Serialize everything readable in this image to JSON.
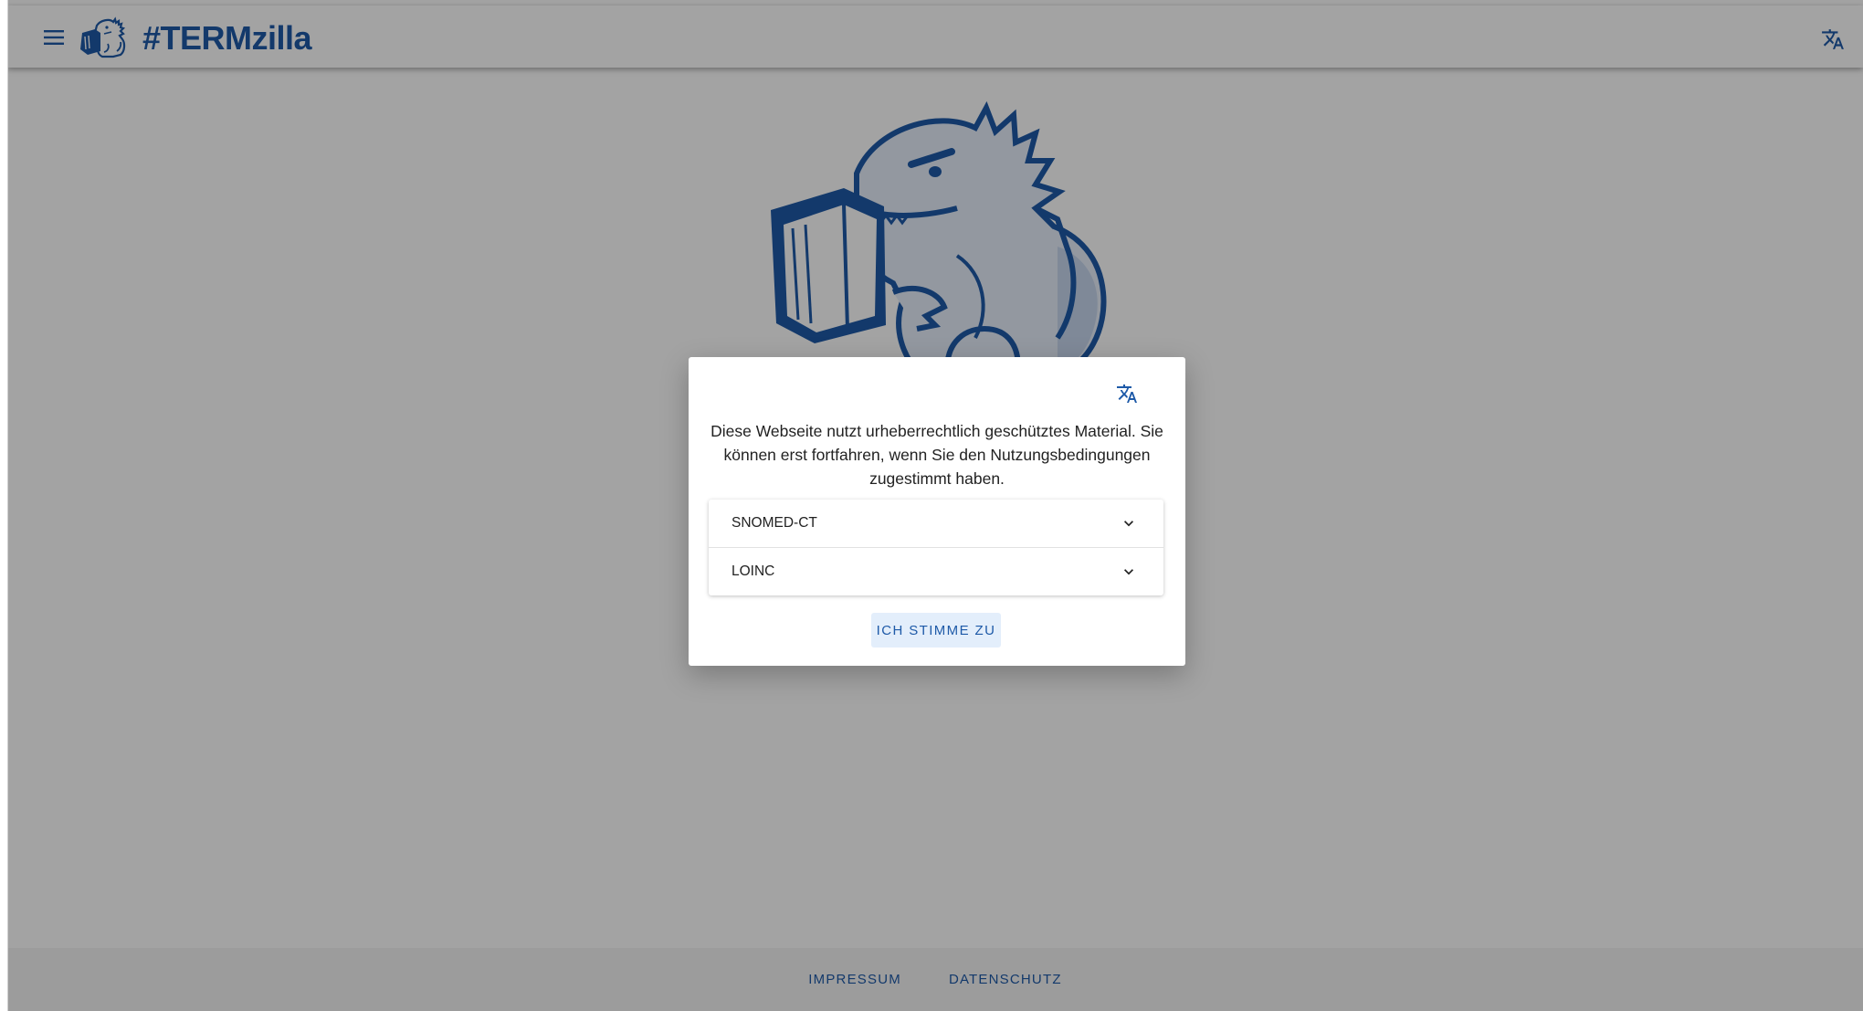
{
  "app": {
    "title": "#TERMzilla"
  },
  "header": {
    "menu_icon": "hamburger-menu-icon",
    "logo_icon": "termzilla-logo-icon",
    "translate_icon": "translate-icon"
  },
  "hero": {
    "image": "dinosaur-reading-book-illustration"
  },
  "dialog": {
    "translate_icon": "translate-icon",
    "message": "Diese Webseite nutzt urheberrechtlich geschütztes Material. Sie können erst fortfahren, wenn Sie den Nutzungsbedingungen zugestimmt haben.",
    "panels": [
      {
        "label": "SNOMED-CT",
        "icon": "chevron-down-icon"
      },
      {
        "label": "LOINC",
        "icon": "chevron-down-icon"
      }
    ],
    "agree_label": "ICH STIMME ZU"
  },
  "footer": {
    "links": [
      {
        "label": "IMPRESSUM"
      },
      {
        "label": "DATENSCHUTZ"
      }
    ]
  },
  "colors": {
    "brand": "#1e5aa8",
    "overlay": "rgba(0,0,0,0.36)",
    "button_bg": "#e3eefb"
  }
}
